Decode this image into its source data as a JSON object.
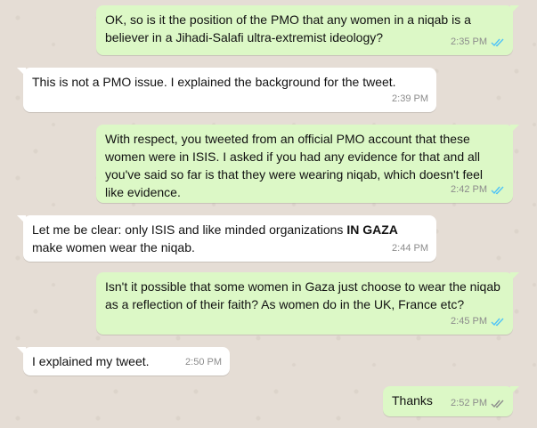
{
  "messages": [
    {
      "dir": "out",
      "text": "OK, so is it the position of the PMO that any women in a niqab is a believer in a Jihadi-Salafi ultra-extremist ideology?",
      "time": "2:35 PM",
      "read": true
    },
    {
      "dir": "in",
      "text": "This is not a PMO issue. I explained the background for the tweet.",
      "time": "2:39 PM"
    },
    {
      "dir": "out",
      "text": "With respect, you tweeted from an official PMO account that these women were in ISIS. I asked if you had any evidence for that and all you've said so far is that they were wearing niqab, which doesn't feel like evidence.",
      "time": "2:42 PM",
      "read": true
    },
    {
      "dir": "in",
      "text_parts": [
        "Let me be clear: only ISIS and like minded organizations ",
        "IN GAZA",
        " make women wear the niqab."
      ],
      "time": "2:44 PM"
    },
    {
      "dir": "out",
      "text": "Isn't it possible that some women in Gaza just choose to wear the niqab as a reflection of their faith? As women do in the UK, France etc?",
      "time": "2:45 PM",
      "read": true
    },
    {
      "dir": "in",
      "text": "I explained my tweet.",
      "time": "2:50 PM"
    },
    {
      "dir": "out",
      "text": "Thanks",
      "time": "2:52 PM",
      "read": false
    }
  ],
  "colors": {
    "outgoing": "#dcf8c6",
    "incoming": "#ffffff",
    "read_ticks": "#4fc3f7",
    "unread_ticks": "#8c8c8c",
    "background": "#e5ddd5"
  }
}
